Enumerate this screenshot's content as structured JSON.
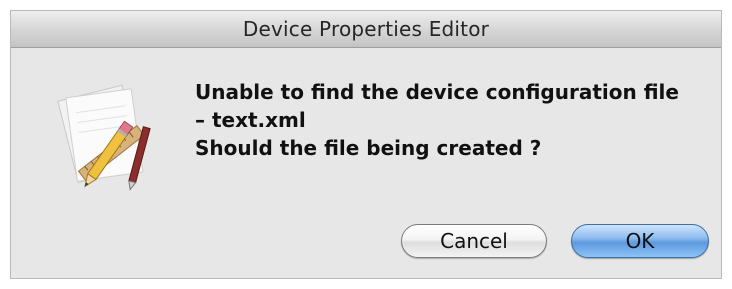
{
  "dialog": {
    "title": "Device Properties Editor",
    "icon": "document-pencil-ruler-icon",
    "message_lines": [
      "Unable to find the device configuration file",
      "– text.xml",
      "Should the file being created ?"
    ],
    "buttons": {
      "cancel_label": "Cancel",
      "ok_label": "OK"
    }
  },
  "colors": {
    "dialog_background": "#e7e7e7",
    "default_button": "#6aa3e6"
  }
}
